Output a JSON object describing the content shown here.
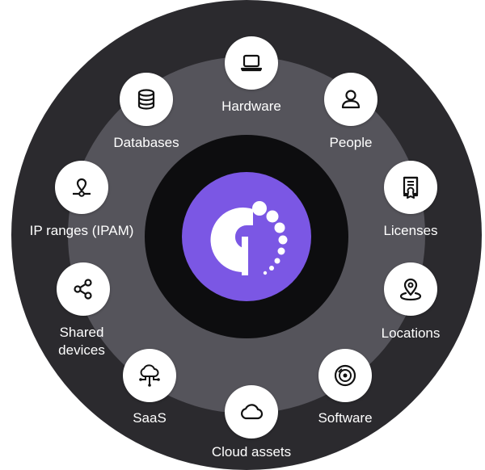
{
  "colors": {
    "outer_ring": "#2b2a2e",
    "middle_ring": "#55545b",
    "inner_ring": "#0d0d0f",
    "logo_fill": "#7b57e4",
    "node_fill": "#ffffff",
    "label_text": "#ffffff"
  },
  "center": {
    "logo_icon": "brand-logo-icon"
  },
  "nodes": [
    {
      "id": "hardware",
      "label": "Hardware",
      "icon": "laptop-icon"
    },
    {
      "id": "people",
      "label": "People",
      "icon": "person-icon"
    },
    {
      "id": "licenses",
      "label": "Licenses",
      "icon": "certificate-icon"
    },
    {
      "id": "locations",
      "label": "Locations",
      "icon": "location-pin-icon"
    },
    {
      "id": "software",
      "label": "Software",
      "icon": "disc-icon"
    },
    {
      "id": "cloud-assets",
      "label": "Cloud assets",
      "icon": "cloud-icon"
    },
    {
      "id": "saas",
      "label": "SaaS",
      "icon": "cloud-network-icon"
    },
    {
      "id": "shared-devices",
      "label_lines": [
        "Shared",
        "devices"
      ],
      "icon": "share-icon"
    },
    {
      "id": "ip-ranges",
      "label": "IP ranges (IPAM)",
      "icon": "network-pin-icon"
    },
    {
      "id": "databases",
      "label": "Databases",
      "icon": "database-icon"
    }
  ]
}
